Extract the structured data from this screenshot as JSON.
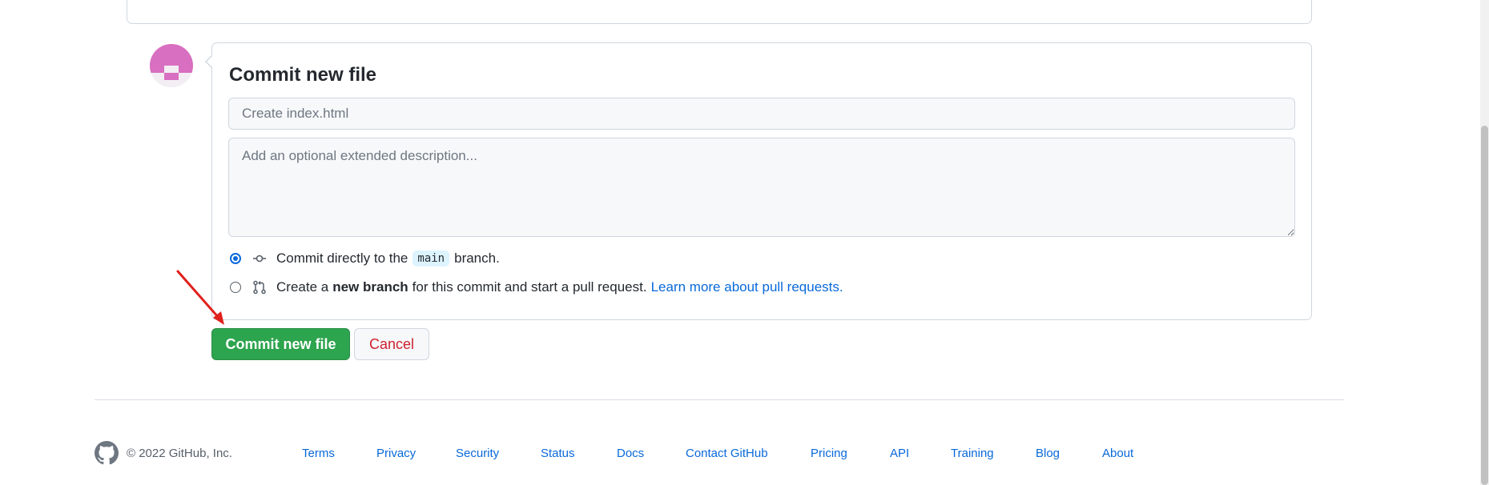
{
  "commit": {
    "title": "Commit new file",
    "summary_placeholder": "Create index.html",
    "summary_value": "",
    "description_placeholder": "Add an optional extended description...",
    "description_value": "",
    "option_direct": {
      "prefix": "Commit directly to the",
      "branch": "main",
      "suffix": "branch.",
      "selected": true
    },
    "option_new_branch": {
      "prefix": "Create a",
      "bold": "new branch",
      "suffix": "for this commit and start a pull request.",
      "link": "Learn more about pull requests.",
      "selected": false
    }
  },
  "actions": {
    "commit_label": "Commit new file",
    "cancel_label": "Cancel"
  },
  "footer": {
    "copyright": "© 2022 GitHub, Inc.",
    "links": [
      "Terms",
      "Privacy",
      "Security",
      "Status",
      "Docs",
      "Contact GitHub",
      "Pricing",
      "API",
      "Training",
      "Blog",
      "About"
    ]
  },
  "colors": {
    "primary_button": "#2da44e",
    "link": "#0969da",
    "cancel_text": "#cf222e",
    "annotation_arrow": "#e0201c",
    "avatar_pink": "#d86fc0"
  },
  "icons": {
    "commit_option_direct": "git-commit-icon",
    "commit_option_branch": "git-pull-request-icon",
    "footer_logo": "github-logo-icon"
  }
}
